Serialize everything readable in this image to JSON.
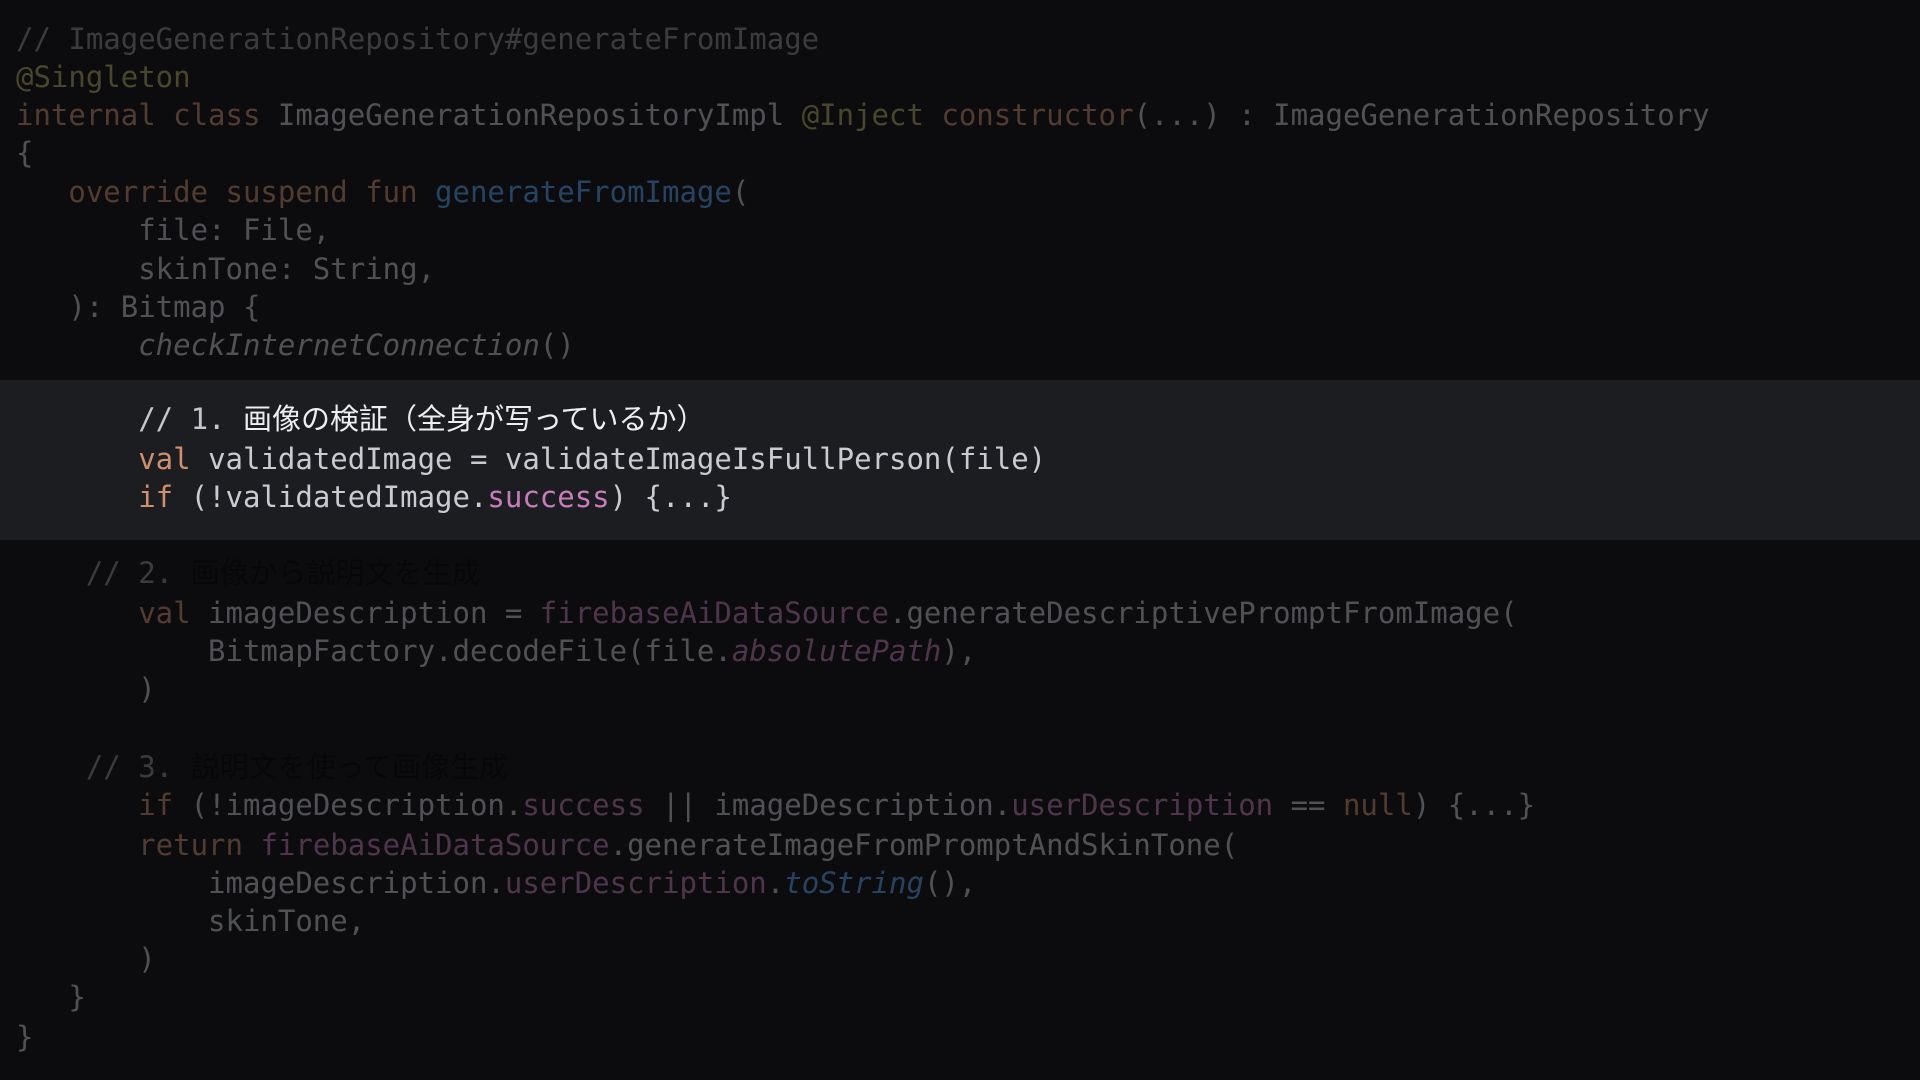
{
  "editor": {
    "lines": [
      {
        "tokens": [
          {
            "t": "// ImageGenerationRepository#generateFromImage",
            "c": "cmt"
          }
        ]
      },
      {
        "tokens": [
          {
            "t": "@Singleton",
            "c": "ann"
          }
        ]
      },
      {
        "tokens": [
          {
            "t": "internal class ",
            "c": "kw"
          },
          {
            "t": "ImageGenerationRepositoryImpl ",
            "c": "def"
          },
          {
            "t": "@Inject ",
            "c": "ann"
          },
          {
            "t": "constructor",
            "c": "kw"
          },
          {
            "t": "(...) : ImageGenerationRepository",
            "c": "def"
          }
        ]
      },
      {
        "tokens": [
          {
            "t": "{",
            "c": "def"
          }
        ]
      },
      {
        "tokens": [
          {
            "t": "   override suspend fun ",
            "c": "kw"
          },
          {
            "t": "generateFromImage",
            "c": "fn"
          },
          {
            "t": "(",
            "c": "def"
          }
        ]
      },
      {
        "tokens": [
          {
            "t": "       file: File,",
            "c": "def"
          }
        ]
      },
      {
        "tokens": [
          {
            "t": "       skinTone: String,",
            "c": "def"
          }
        ]
      },
      {
        "tokens": [
          {
            "t": "   ): Bitmap {",
            "c": "def"
          }
        ]
      },
      {
        "tokens": [
          {
            "t": "       ",
            "c": "def"
          },
          {
            "t": "checkInternetConnection",
            "c": "def",
            "italic": true
          },
          {
            "t": "()",
            "c": "def"
          }
        ]
      },
      {
        "tokens": [
          {
            "t": "       // 1. ",
            "c": "cmt-bright"
          },
          {
            "t": "画像の検証（全身が写っているか）",
            "c": "jp-bright"
          }
        ],
        "bright": true
      },
      {
        "tokens": [
          {
            "t": "       val ",
            "c": "kw"
          },
          {
            "t": "validatedImage = validateImageIsFullPerson(file)",
            "c": "def"
          }
        ],
        "bright": true
      },
      {
        "tokens": [
          {
            "t": "       if ",
            "c": "kw"
          },
          {
            "t": "(!validatedImage.",
            "c": "def"
          },
          {
            "t": "success",
            "c": "prop"
          },
          {
            "t": ") {...}",
            "c": "def"
          }
        ],
        "bright": true
      },
      {
        "tokens": [
          {
            "t": "    // 2. ",
            "c": "cmt"
          },
          {
            "t": "画像から説明文を生成",
            "c": "jp"
          }
        ]
      },
      {
        "tokens": [
          {
            "t": "       val ",
            "c": "kw"
          },
          {
            "t": "imageDescription = ",
            "c": "def"
          },
          {
            "t": "firebaseAiDataSource",
            "c": "prop"
          },
          {
            "t": ".generateDescriptivePromptFromImage(",
            "c": "def"
          }
        ]
      },
      {
        "tokens": [
          {
            "t": "           BitmapFactory.decodeFile(file.",
            "c": "def"
          },
          {
            "t": "absolutePath",
            "c": "prop",
            "italic": true
          },
          {
            "t": "),",
            "c": "def"
          }
        ]
      },
      {
        "tokens": [
          {
            "t": "       )",
            "c": "def"
          }
        ]
      },
      {
        "tokens": [
          {
            "t": "",
            "c": "def"
          }
        ]
      },
      {
        "tokens": [
          {
            "t": "    // 3. ",
            "c": "cmt"
          },
          {
            "t": "説明文を使って画像生成",
            "c": "jp"
          }
        ]
      },
      {
        "tokens": [
          {
            "t": "       if ",
            "c": "kw"
          },
          {
            "t": "(!imageDescription.",
            "c": "def"
          },
          {
            "t": "success",
            "c": "prop"
          },
          {
            "t": " || imageDescription.",
            "c": "def"
          },
          {
            "t": "userDescription",
            "c": "prop"
          },
          {
            "t": " == ",
            "c": "def"
          },
          {
            "t": "null",
            "c": "kw"
          },
          {
            "t": ") {...}",
            "c": "def"
          }
        ]
      },
      {
        "tokens": [
          {
            "t": "       return ",
            "c": "kw"
          },
          {
            "t": "firebaseAiDataSource",
            "c": "prop"
          },
          {
            "t": ".generateImageFromPromptAndSkinTone(",
            "c": "def"
          }
        ]
      },
      {
        "tokens": [
          {
            "t": "           imageDescription.",
            "c": "def"
          },
          {
            "t": "userDescription",
            "c": "prop"
          },
          {
            "t": ".",
            "c": "def"
          },
          {
            "t": "toString",
            "c": "fn",
            "italic": true
          },
          {
            "t": "(),",
            "c": "def"
          }
        ]
      },
      {
        "tokens": [
          {
            "t": "           skinTone,",
            "c": "def"
          }
        ]
      },
      {
        "tokens": [
          {
            "t": "       )",
            "c": "def"
          }
        ]
      },
      {
        "tokens": [
          {
            "t": "   }",
            "c": "def"
          }
        ]
      },
      {
        "tokens": [
          {
            "t": "}",
            "c": "def"
          }
        ]
      }
    ]
  },
  "colors": {
    "background": "#0c0c0e",
    "highlight_band": "#1c1d21",
    "keyword": "#cf8e6d",
    "annotation": "#b3ae60",
    "function": "#56a8f5",
    "property": "#c77dbb",
    "text": "#c9cbd1",
    "comment": "#8e8f93"
  }
}
